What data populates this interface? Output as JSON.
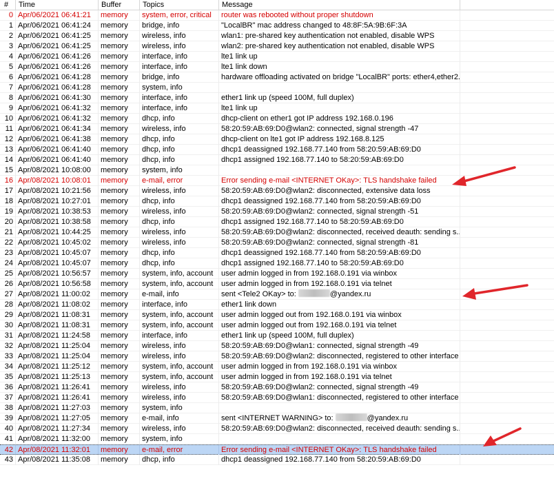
{
  "columns": {
    "num": "#",
    "time": "Time",
    "buffer": "Buffer",
    "topics": "Topics",
    "message": "Message"
  },
  "rows": [
    {
      "num": "0",
      "time": "Apr/06/2021 06:41:21",
      "buffer": "memory",
      "topics": "system, error, critical",
      "message": "router was rebooted without proper shutdown",
      "error": true
    },
    {
      "num": "1",
      "time": "Apr/06/2021 06:41:24",
      "buffer": "memory",
      "topics": "bridge, info",
      "message": "\"LocalBR\" mac address changed to 48:8F:5A:9B:6F:3A"
    },
    {
      "num": "2",
      "time": "Apr/06/2021 06:41:25",
      "buffer": "memory",
      "topics": "wireless, info",
      "message": "wlan1: pre-shared key authentication not enabled, disable WPS"
    },
    {
      "num": "3",
      "time": "Apr/06/2021 06:41:25",
      "buffer": "memory",
      "topics": "wireless, info",
      "message": "wlan2: pre-shared key authentication not enabled, disable WPS"
    },
    {
      "num": "4",
      "time": "Apr/06/2021 06:41:26",
      "buffer": "memory",
      "topics": "interface, info",
      "message": "lte1 link up"
    },
    {
      "num": "5",
      "time": "Apr/06/2021 06:41:26",
      "buffer": "memory",
      "topics": "interface, info",
      "message": "lte1 link down"
    },
    {
      "num": "6",
      "time": "Apr/06/2021 06:41:28",
      "buffer": "memory",
      "topics": "bridge, info",
      "message": "hardware offloading activated on bridge \"LocalBR\" ports: ether4,ether2..."
    },
    {
      "num": "7",
      "time": "Apr/06/2021 06:41:28",
      "buffer": "memory",
      "topics": "system, info",
      "message": ""
    },
    {
      "num": "8",
      "time": "Apr/06/2021 06:41:30",
      "buffer": "memory",
      "topics": "interface, info",
      "message": "ether1 link up (speed 100M, full duplex)"
    },
    {
      "num": "9",
      "time": "Apr/06/2021 06:41:32",
      "buffer": "memory",
      "topics": "interface, info",
      "message": "lte1 link up"
    },
    {
      "num": "10",
      "time": "Apr/06/2021 06:41:32",
      "buffer": "memory",
      "topics": "dhcp, info",
      "message": "dhcp-client on ether1 got IP address 192.168.0.196"
    },
    {
      "num": "11",
      "time": "Apr/06/2021 06:41:34",
      "buffer": "memory",
      "topics": "wireless, info",
      "message": "58:20:59:AB:69:D0@wlan2: connected, signal strength -47"
    },
    {
      "num": "12",
      "time": "Apr/06/2021 06:41:38",
      "buffer": "memory",
      "topics": "dhcp, info",
      "message": "dhcp-client on lte1 got IP address 192.168.8.125"
    },
    {
      "num": "13",
      "time": "Apr/06/2021 06:41:40",
      "buffer": "memory",
      "topics": "dhcp, info",
      "message": "dhcp1 deassigned 192.168.77.140 from 58:20:59:AB:69:D0"
    },
    {
      "num": "14",
      "time": "Apr/06/2021 06:41:40",
      "buffer": "memory",
      "topics": "dhcp, info",
      "message": "dhcp1 assigned 192.168.77.140 to 58:20:59:AB:69:D0"
    },
    {
      "num": "15",
      "time": "Apr/08/2021 10:08:00",
      "buffer": "memory",
      "topics": "system, info",
      "message": ""
    },
    {
      "num": "16",
      "time": "Apr/08/2021 10:08:01",
      "buffer": "memory",
      "topics": "e-mail, error",
      "message": "Error sending e-mail <INTERNET OKay>: TLS handshake failed",
      "error": true
    },
    {
      "num": "17",
      "time": "Apr/08/2021 10:21:56",
      "buffer": "memory",
      "topics": "wireless, info",
      "message": "58:20:59:AB:69:D0@wlan2: disconnected, extensive data loss"
    },
    {
      "num": "18",
      "time": "Apr/08/2021 10:27:01",
      "buffer": "memory",
      "topics": "dhcp, info",
      "message": "dhcp1 deassigned 192.168.77.140 from 58:20:59:AB:69:D0"
    },
    {
      "num": "19",
      "time": "Apr/08/2021 10:38:53",
      "buffer": "memory",
      "topics": "wireless, info",
      "message": "58:20:59:AB:69:D0@wlan2: connected, signal strength -51"
    },
    {
      "num": "20",
      "time": "Apr/08/2021 10:38:58",
      "buffer": "memory",
      "topics": "dhcp, info",
      "message": "dhcp1 assigned 192.168.77.140 to 58:20:59:AB:69:D0"
    },
    {
      "num": "21",
      "time": "Apr/08/2021 10:44:25",
      "buffer": "memory",
      "topics": "wireless, info",
      "message": "58:20:59:AB:69:D0@wlan2: disconnected, received deauth: sending s..."
    },
    {
      "num": "22",
      "time": "Apr/08/2021 10:45:02",
      "buffer": "memory",
      "topics": "wireless, info",
      "message": "58:20:59:AB:69:D0@wlan2: connected, signal strength -81"
    },
    {
      "num": "23",
      "time": "Apr/08/2021 10:45:07",
      "buffer": "memory",
      "topics": "dhcp, info",
      "message": "dhcp1 deassigned 192.168.77.140 from 58:20:59:AB:69:D0"
    },
    {
      "num": "24",
      "time": "Apr/08/2021 10:45:07",
      "buffer": "memory",
      "topics": "dhcp, info",
      "message": "dhcp1 assigned 192.168.77.140 to 58:20:59:AB:69:D0"
    },
    {
      "num": "25",
      "time": "Apr/08/2021 10:56:57",
      "buffer": "memory",
      "topics": "system, info, account",
      "message": "user admin logged in from 192.168.0.191 via winbox"
    },
    {
      "num": "26",
      "time": "Apr/08/2021 10:56:58",
      "buffer": "memory",
      "topics": "system, info, account",
      "message": "user admin logged in from 192.168.0.191 via telnet"
    },
    {
      "num": "27",
      "time": "Apr/08/2021 11:00:02",
      "buffer": "memory",
      "topics": "e-mail, info",
      "message": "sent <Tele2 OKay> to:",
      "redacted_suffix": "@yandex.ru"
    },
    {
      "num": "28",
      "time": "Apr/08/2021 11:08:02",
      "buffer": "memory",
      "topics": "interface, info",
      "message": "ether1 link down"
    },
    {
      "num": "29",
      "time": "Apr/08/2021 11:08:31",
      "buffer": "memory",
      "topics": "system, info, account",
      "message": "user admin logged out from 192.168.0.191 via winbox"
    },
    {
      "num": "30",
      "time": "Apr/08/2021 11:08:31",
      "buffer": "memory",
      "topics": "system, info, account",
      "message": "user admin logged out from 192.168.0.191 via telnet"
    },
    {
      "num": "31",
      "time": "Apr/08/2021 11:24:58",
      "buffer": "memory",
      "topics": "interface, info",
      "message": "ether1 link up (speed 100M, full duplex)"
    },
    {
      "num": "32",
      "time": "Apr/08/2021 11:25:04",
      "buffer": "memory",
      "topics": "wireless, info",
      "message": "58:20:59:AB:69:D0@wlan1: connected, signal strength -49"
    },
    {
      "num": "33",
      "time": "Apr/08/2021 11:25:04",
      "buffer": "memory",
      "topics": "wireless, info",
      "message": "58:20:59:AB:69:D0@wlan2: disconnected, registered to other interface"
    },
    {
      "num": "34",
      "time": "Apr/08/2021 11:25:12",
      "buffer": "memory",
      "topics": "system, info, account",
      "message": "user admin logged in from 192.168.0.191 via winbox"
    },
    {
      "num": "35",
      "time": "Apr/08/2021 11:25:13",
      "buffer": "memory",
      "topics": "system, info, account",
      "message": "user admin logged in from 192.168.0.191 via telnet"
    },
    {
      "num": "36",
      "time": "Apr/08/2021 11:26:41",
      "buffer": "memory",
      "topics": "wireless, info",
      "message": "58:20:59:AB:69:D0@wlan2: connected, signal strength -49"
    },
    {
      "num": "37",
      "time": "Apr/08/2021 11:26:41",
      "buffer": "memory",
      "topics": "wireless, info",
      "message": "58:20:59:AB:69:D0@wlan1: disconnected, registered to other interface"
    },
    {
      "num": "38",
      "time": "Apr/08/2021 11:27:03",
      "buffer": "memory",
      "topics": "system, info",
      "message": ""
    },
    {
      "num": "39",
      "time": "Apr/08/2021 11:27:05",
      "buffer": "memory",
      "topics": "e-mail, info",
      "message": "sent <INTERNET WARNING> to:",
      "redacted_suffix": "@yandex.ru"
    },
    {
      "num": "40",
      "time": "Apr/08/2021 11:27:34",
      "buffer": "memory",
      "topics": "wireless, info",
      "message": "58:20:59:AB:69:D0@wlan2: disconnected, received deauth: sending s..."
    },
    {
      "num": "41",
      "time": "Apr/08/2021 11:32:00",
      "buffer": "memory",
      "topics": "system, info",
      "message": ""
    },
    {
      "num": "42",
      "time": "Apr/08/2021 11:32:01",
      "buffer": "memory",
      "topics": "e-mail, error",
      "message": "Error sending e-mail <INTERNET OKay>: TLS handshake failed",
      "error": true,
      "selected": true
    },
    {
      "num": "43",
      "time": "Apr/08/2021 11:35:08",
      "buffer": "memory",
      "topics": "dhcp, info",
      "message": "dhcp1 deassigned 192.168.77.140 from 58:20:59:AB:69:D0"
    }
  ],
  "colors": {
    "error_text": "#d40000",
    "selected_bg": "#bcd6f5",
    "arrow": "#e0262b"
  },
  "annotations": [
    {
      "type": "arrow",
      "icon": "arrow-icon",
      "points_to_row": "16"
    },
    {
      "type": "arrow",
      "icon": "arrow-icon",
      "points_to_row": "27"
    },
    {
      "type": "arrow",
      "icon": "arrow-icon",
      "points_to_row": "42"
    }
  ]
}
